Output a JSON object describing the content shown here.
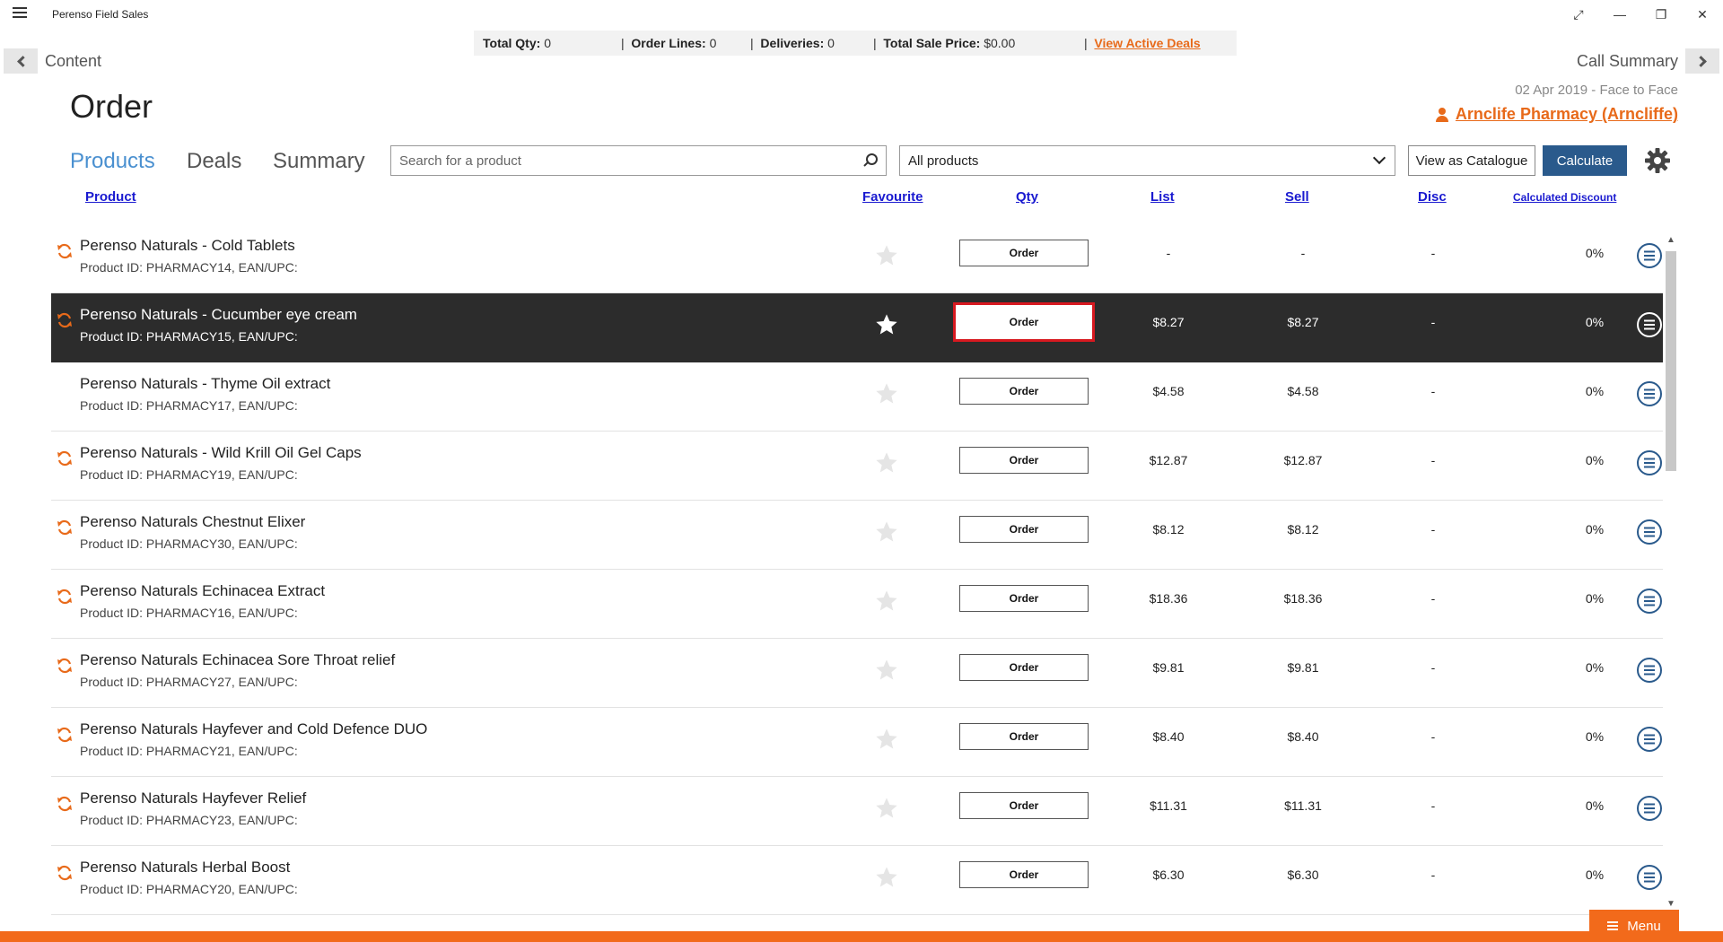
{
  "app": {
    "title": "Perenso Field Sales"
  },
  "summary": {
    "total_qty_label": "Total Qty:",
    "total_qty": "0",
    "order_lines_label": "Order Lines:",
    "order_lines": "0",
    "deliveries_label": "Deliveries:",
    "deliveries": "0",
    "total_sale_label": "Total Sale Price:",
    "total_sale": "$0.00",
    "deals_link": "View Active Deals"
  },
  "nav": {
    "back_label": "Content",
    "forward_label": "Call Summary"
  },
  "page": {
    "title": "Order",
    "call_date": "02 Apr 2019  -  Face to Face",
    "customer": "Arnclife Pharmacy (Arncliffe)"
  },
  "tabs": [
    {
      "label": "Products",
      "active": true
    },
    {
      "label": "Deals",
      "active": false
    },
    {
      "label": "Summary",
      "active": false
    }
  ],
  "search": {
    "placeholder": "Search for a product",
    "value": ""
  },
  "filter": {
    "selected": "All products"
  },
  "buttons": {
    "catalogue": "View as Catalogue",
    "calculate": "Calculate"
  },
  "columns": {
    "product": "Product",
    "favourite": "Favourite",
    "qty": "Qty",
    "list": "List",
    "sell": "Sell",
    "disc": "Disc",
    "calc": "Calculated Discount"
  },
  "order_label": "Order",
  "menu_label": "Menu",
  "colors": {
    "accent": "#f26a1b",
    "link": "#1a1ad0",
    "tab_active": "#4a90d0",
    "calculate": "#2a5a8c",
    "selected_row": "#2c2c2c",
    "highlight": "#d71920"
  },
  "products": [
    {
      "name": "Perenso Naturals - Cold Tablets",
      "id": "Product ID: PHARMACY14, EAN/UPC:",
      "list": "-",
      "sell": "-",
      "disc": "-",
      "calc": "0%",
      "sync": true,
      "selected": false
    },
    {
      "name": "Perenso Naturals - Cucumber eye cream",
      "id": "Product ID: PHARMACY15, EAN/UPC:",
      "list": "$8.27",
      "sell": "$8.27",
      "disc": "-",
      "calc": "0%",
      "sync": true,
      "selected": true
    },
    {
      "name": "Perenso Naturals - Thyme Oil extract",
      "id": "Product ID: PHARMACY17, EAN/UPC:",
      "list": "$4.58",
      "sell": "$4.58",
      "disc": "-",
      "calc": "0%",
      "sync": false,
      "selected": false
    },
    {
      "name": "Perenso Naturals - Wild Krill Oil Gel Caps",
      "id": "Product ID: PHARMACY19, EAN/UPC:",
      "list": "$12.87",
      "sell": "$12.87",
      "disc": "-",
      "calc": "0%",
      "sync": true,
      "selected": false
    },
    {
      "name": "Perenso Naturals Chestnut Elixer",
      "id": "Product ID: PHARMACY30, EAN/UPC:",
      "list": "$8.12",
      "sell": "$8.12",
      "disc": "-",
      "calc": "0%",
      "sync": true,
      "selected": false
    },
    {
      "name": "Perenso Naturals Echinacea Extract",
      "id": "Product ID: PHARMACY16, EAN/UPC:",
      "list": "$18.36",
      "sell": "$18.36",
      "disc": "-",
      "calc": "0%",
      "sync": true,
      "selected": false
    },
    {
      "name": "Perenso Naturals Echinacea Sore Throat relief",
      "id": "Product ID: PHARMACY27, EAN/UPC:",
      "list": "$9.81",
      "sell": "$9.81",
      "disc": "-",
      "calc": "0%",
      "sync": true,
      "selected": false
    },
    {
      "name": "Perenso Naturals Hayfever and Cold Defence DUO",
      "id": "Product ID: PHARMACY21, EAN/UPC:",
      "list": "$8.40",
      "sell": "$8.40",
      "disc": "-",
      "calc": "0%",
      "sync": true,
      "selected": false
    },
    {
      "name": "Perenso Naturals Hayfever Relief",
      "id": "Product ID: PHARMACY23, EAN/UPC:",
      "list": "$11.31",
      "sell": "$11.31",
      "disc": "-",
      "calc": "0%",
      "sync": true,
      "selected": false
    },
    {
      "name": "Perenso Naturals Herbal Boost",
      "id": "Product ID: PHARMACY20, EAN/UPC:",
      "list": "$6.30",
      "sell": "$6.30",
      "disc": "-",
      "calc": "0%",
      "sync": true,
      "selected": false
    }
  ]
}
